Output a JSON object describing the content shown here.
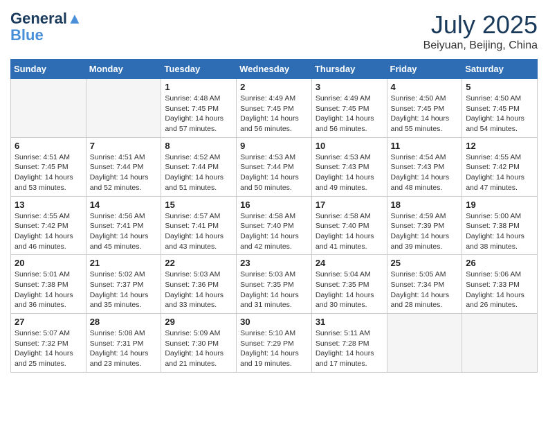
{
  "header": {
    "logo_line1": "General",
    "logo_line2": "Blue",
    "month_title": "July 2025",
    "subtitle": "Beiyuan, Beijing, China"
  },
  "weekdays": [
    "Sunday",
    "Monday",
    "Tuesday",
    "Wednesday",
    "Thursday",
    "Friday",
    "Saturday"
  ],
  "weeks": [
    [
      {
        "day": "",
        "info": ""
      },
      {
        "day": "",
        "info": ""
      },
      {
        "day": "1",
        "sunrise": "Sunrise: 4:48 AM",
        "sunset": "Sunset: 7:45 PM",
        "daylight": "Daylight: 14 hours and 57 minutes."
      },
      {
        "day": "2",
        "sunrise": "Sunrise: 4:49 AM",
        "sunset": "Sunset: 7:45 PM",
        "daylight": "Daylight: 14 hours and 56 minutes."
      },
      {
        "day": "3",
        "sunrise": "Sunrise: 4:49 AM",
        "sunset": "Sunset: 7:45 PM",
        "daylight": "Daylight: 14 hours and 56 minutes."
      },
      {
        "day": "4",
        "sunrise": "Sunrise: 4:50 AM",
        "sunset": "Sunset: 7:45 PM",
        "daylight": "Daylight: 14 hours and 55 minutes."
      },
      {
        "day": "5",
        "sunrise": "Sunrise: 4:50 AM",
        "sunset": "Sunset: 7:45 PM",
        "daylight": "Daylight: 14 hours and 54 minutes."
      }
    ],
    [
      {
        "day": "6",
        "sunrise": "Sunrise: 4:51 AM",
        "sunset": "Sunset: 7:45 PM",
        "daylight": "Daylight: 14 hours and 53 minutes."
      },
      {
        "day": "7",
        "sunrise": "Sunrise: 4:51 AM",
        "sunset": "Sunset: 7:44 PM",
        "daylight": "Daylight: 14 hours and 52 minutes."
      },
      {
        "day": "8",
        "sunrise": "Sunrise: 4:52 AM",
        "sunset": "Sunset: 7:44 PM",
        "daylight": "Daylight: 14 hours and 51 minutes."
      },
      {
        "day": "9",
        "sunrise": "Sunrise: 4:53 AM",
        "sunset": "Sunset: 7:44 PM",
        "daylight": "Daylight: 14 hours and 50 minutes."
      },
      {
        "day": "10",
        "sunrise": "Sunrise: 4:53 AM",
        "sunset": "Sunset: 7:43 PM",
        "daylight": "Daylight: 14 hours and 49 minutes."
      },
      {
        "day": "11",
        "sunrise": "Sunrise: 4:54 AM",
        "sunset": "Sunset: 7:43 PM",
        "daylight": "Daylight: 14 hours and 48 minutes."
      },
      {
        "day": "12",
        "sunrise": "Sunrise: 4:55 AM",
        "sunset": "Sunset: 7:42 PM",
        "daylight": "Daylight: 14 hours and 47 minutes."
      }
    ],
    [
      {
        "day": "13",
        "sunrise": "Sunrise: 4:55 AM",
        "sunset": "Sunset: 7:42 PM",
        "daylight": "Daylight: 14 hours and 46 minutes."
      },
      {
        "day": "14",
        "sunrise": "Sunrise: 4:56 AM",
        "sunset": "Sunset: 7:41 PM",
        "daylight": "Daylight: 14 hours and 45 minutes."
      },
      {
        "day": "15",
        "sunrise": "Sunrise: 4:57 AM",
        "sunset": "Sunset: 7:41 PM",
        "daylight": "Daylight: 14 hours and 43 minutes."
      },
      {
        "day": "16",
        "sunrise": "Sunrise: 4:58 AM",
        "sunset": "Sunset: 7:40 PM",
        "daylight": "Daylight: 14 hours and 42 minutes."
      },
      {
        "day": "17",
        "sunrise": "Sunrise: 4:58 AM",
        "sunset": "Sunset: 7:40 PM",
        "daylight": "Daylight: 14 hours and 41 minutes."
      },
      {
        "day": "18",
        "sunrise": "Sunrise: 4:59 AM",
        "sunset": "Sunset: 7:39 PM",
        "daylight": "Daylight: 14 hours and 39 minutes."
      },
      {
        "day": "19",
        "sunrise": "Sunrise: 5:00 AM",
        "sunset": "Sunset: 7:38 PM",
        "daylight": "Daylight: 14 hours and 38 minutes."
      }
    ],
    [
      {
        "day": "20",
        "sunrise": "Sunrise: 5:01 AM",
        "sunset": "Sunset: 7:38 PM",
        "daylight": "Daylight: 14 hours and 36 minutes."
      },
      {
        "day": "21",
        "sunrise": "Sunrise: 5:02 AM",
        "sunset": "Sunset: 7:37 PM",
        "daylight": "Daylight: 14 hours and 35 minutes."
      },
      {
        "day": "22",
        "sunrise": "Sunrise: 5:03 AM",
        "sunset": "Sunset: 7:36 PM",
        "daylight": "Daylight: 14 hours and 33 minutes."
      },
      {
        "day": "23",
        "sunrise": "Sunrise: 5:03 AM",
        "sunset": "Sunset: 7:35 PM",
        "daylight": "Daylight: 14 hours and 31 minutes."
      },
      {
        "day": "24",
        "sunrise": "Sunrise: 5:04 AM",
        "sunset": "Sunset: 7:35 PM",
        "daylight": "Daylight: 14 hours and 30 minutes."
      },
      {
        "day": "25",
        "sunrise": "Sunrise: 5:05 AM",
        "sunset": "Sunset: 7:34 PM",
        "daylight": "Daylight: 14 hours and 28 minutes."
      },
      {
        "day": "26",
        "sunrise": "Sunrise: 5:06 AM",
        "sunset": "Sunset: 7:33 PM",
        "daylight": "Daylight: 14 hours and 26 minutes."
      }
    ],
    [
      {
        "day": "27",
        "sunrise": "Sunrise: 5:07 AM",
        "sunset": "Sunset: 7:32 PM",
        "daylight": "Daylight: 14 hours and 25 minutes."
      },
      {
        "day": "28",
        "sunrise": "Sunrise: 5:08 AM",
        "sunset": "Sunset: 7:31 PM",
        "daylight": "Daylight: 14 hours and 23 minutes."
      },
      {
        "day": "29",
        "sunrise": "Sunrise: 5:09 AM",
        "sunset": "Sunset: 7:30 PM",
        "daylight": "Daylight: 14 hours and 21 minutes."
      },
      {
        "day": "30",
        "sunrise": "Sunrise: 5:10 AM",
        "sunset": "Sunset: 7:29 PM",
        "daylight": "Daylight: 14 hours and 19 minutes."
      },
      {
        "day": "31",
        "sunrise": "Sunrise: 5:11 AM",
        "sunset": "Sunset: 7:28 PM",
        "daylight": "Daylight: 14 hours and 17 minutes."
      },
      {
        "day": "",
        "info": ""
      },
      {
        "day": "",
        "info": ""
      }
    ]
  ]
}
